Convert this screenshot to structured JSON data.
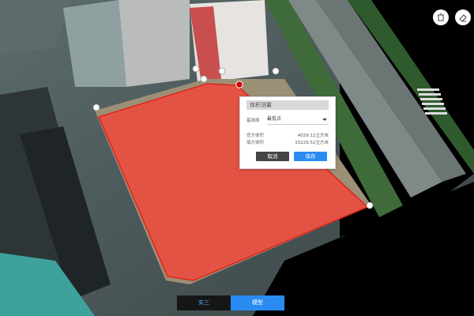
{
  "toolbar": {
    "delete_icon": "trash-icon",
    "erase_icon": "eraser-icon"
  },
  "panel": {
    "title": "体积测量",
    "base_label": "基准面",
    "base_value": "最低点",
    "cut_label": "挖方体积",
    "cut_value": "4029.12立方米",
    "fill_label": "填方体积",
    "fill_value": "15229.52立方米",
    "cancel_label": "取消",
    "save_label": "保存"
  },
  "tabs": [
    {
      "label": "实三"
    },
    {
      "label": "模型"
    }
  ],
  "colors": {
    "overlay": "#ff3b2f",
    "accent": "#2a8cf2"
  }
}
